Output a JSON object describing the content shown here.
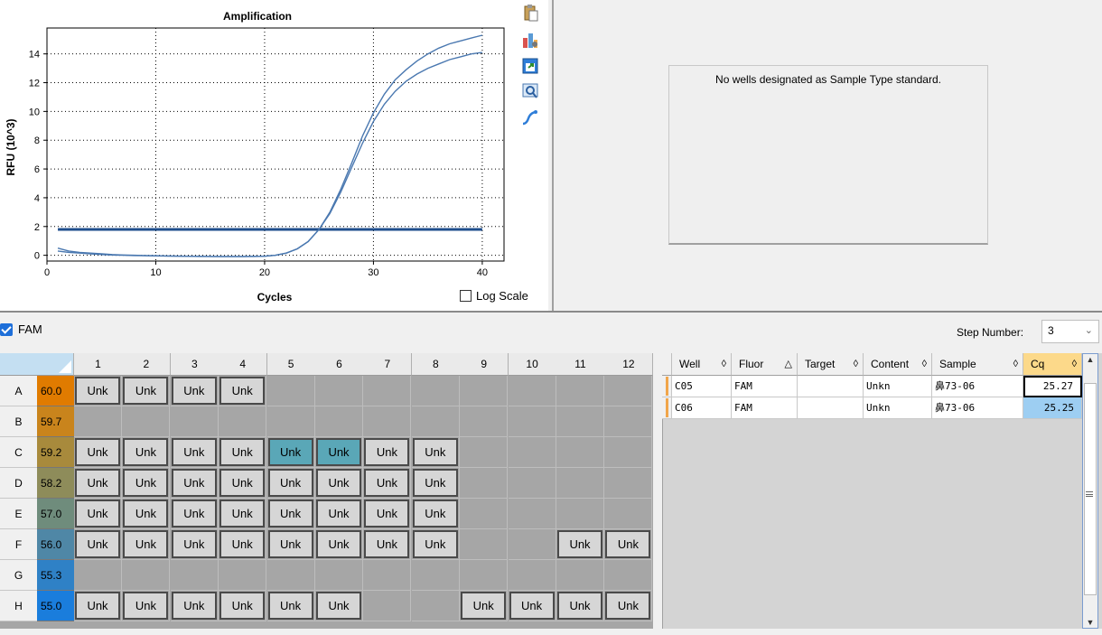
{
  "chart_data": {
    "type": "line",
    "title": "Amplification",
    "xlabel": "Cycles",
    "ylabel": "RFU (10^3)",
    "xlim": [
      0,
      42
    ],
    "ylim": [
      -0.4,
      15.8
    ],
    "xticks": [
      0,
      10,
      20,
      30,
      40
    ],
    "yticks": [
      0,
      2,
      4,
      6,
      8,
      10,
      12,
      14
    ],
    "grid": true,
    "threshold": 1.8,
    "x": [
      1,
      2,
      3,
      4,
      5,
      6,
      7,
      8,
      9,
      10,
      11,
      12,
      13,
      14,
      15,
      16,
      17,
      18,
      19,
      20,
      21,
      22,
      23,
      24,
      25,
      26,
      27,
      28,
      29,
      30,
      31,
      32,
      33,
      34,
      35,
      36,
      37,
      38,
      39,
      40
    ],
    "series": [
      {
        "values": [
          0.5,
          0.3,
          0.2,
          0.15,
          0.1,
          0.05,
          0.02,
          0.0,
          -0.02,
          -0.03,
          -0.05,
          -0.06,
          -0.07,
          -0.08,
          -0.08,
          -0.09,
          -0.09,
          -0.09,
          -0.08,
          -0.07,
          0.0,
          0.15,
          0.45,
          0.95,
          1.8,
          3.0,
          4.6,
          6.4,
          8.3,
          9.9,
          11.2,
          12.2,
          12.9,
          13.5,
          14.0,
          14.4,
          14.7,
          14.9,
          15.1,
          15.3
        ]
      },
      {
        "values": [
          0.3,
          0.2,
          0.15,
          0.1,
          0.05,
          0.02,
          0.0,
          -0.02,
          -0.03,
          -0.04,
          -0.05,
          -0.06,
          -0.07,
          -0.07,
          -0.08,
          -0.08,
          -0.08,
          -0.08,
          -0.07,
          -0.06,
          0.0,
          0.15,
          0.45,
          0.95,
          1.8,
          2.9,
          4.4,
          6.1,
          7.8,
          9.3,
          10.5,
          11.4,
          12.1,
          12.6,
          13.0,
          13.3,
          13.6,
          13.8,
          14.0,
          14.1
        ]
      }
    ],
    "colors": {
      "curves": "#4a78b0",
      "threshold": "#1f4e8c"
    }
  },
  "chart": {
    "log_scale_label": "Log Scale",
    "log_scale_checked": false,
    "tools": [
      "clipboard-icon",
      "chart-settings-icon",
      "export-icon",
      "zoom-icon",
      "curve-fit-icon"
    ]
  },
  "standard_curve": {
    "message": "No wells designated as Sample Type standard."
  },
  "fluor_toggle": {
    "label": "FAM",
    "checked": true
  },
  "step": {
    "label": "Step Number:",
    "value": "3"
  },
  "plate": {
    "columns": [
      "1",
      "2",
      "3",
      "4",
      "5",
      "6",
      "7",
      "8",
      "9",
      "10",
      "11",
      "12"
    ],
    "rows": [
      {
        "label": "A",
        "temp": "60.0",
        "color": "#e07b00",
        "wells": [
          "Unk",
          "Unk",
          "Unk",
          "Unk",
          "",
          "",
          "",
          "",
          "",
          "",
          "",
          ""
        ]
      },
      {
        "label": "B",
        "temp": "59.7",
        "color": "#c9841c",
        "wells": [
          "",
          "",
          "",
          "",
          "",
          "",
          "",
          "",
          "",
          "",
          "",
          ""
        ]
      },
      {
        "label": "C",
        "temp": "59.2",
        "color": "#a88a3c",
        "wells": [
          "Unk",
          "Unk",
          "Unk",
          "Unk",
          "Unk",
          "Unk",
          "Unk",
          "Unk",
          "",
          "",
          "",
          ""
        ]
      },
      {
        "label": "D",
        "temp": "58.2",
        "color": "#8e8c5a",
        "wells": [
          "Unk",
          "Unk",
          "Unk",
          "Unk",
          "Unk",
          "Unk",
          "Unk",
          "Unk",
          "",
          "",
          "",
          ""
        ]
      },
      {
        "label": "E",
        "temp": "57.0",
        "color": "#6f8c7c",
        "wells": [
          "Unk",
          "Unk",
          "Unk",
          "Unk",
          "Unk",
          "Unk",
          "Unk",
          "Unk",
          "",
          "",
          "",
          ""
        ]
      },
      {
        "label": "F",
        "temp": "56.0",
        "color": "#4f87a6",
        "wells": [
          "Unk",
          "Unk",
          "Unk",
          "Unk",
          "Unk",
          "Unk",
          "Unk",
          "Unk",
          "",
          "",
          "Unk",
          "Unk"
        ]
      },
      {
        "label": "G",
        "temp": "55.3",
        "color": "#2f81c6",
        "wells": [
          "",
          "",
          "",
          "",
          "",
          "",
          "",
          "",
          "",
          "",
          "",
          ""
        ]
      },
      {
        "label": "H",
        "temp": "55.0",
        "color": "#1a7ddc",
        "wells": [
          "Unk",
          "Unk",
          "Unk",
          "Unk",
          "Unk",
          "Unk",
          "",
          "",
          "Unk",
          "Unk",
          "Unk",
          "Unk"
        ]
      }
    ],
    "selected": [
      [
        2,
        4
      ],
      [
        2,
        5
      ]
    ]
  },
  "results": {
    "headers": [
      {
        "label": "Well",
        "sort": "◊"
      },
      {
        "label": "Fluor",
        "sort": "△"
      },
      {
        "label": "Target",
        "sort": "◊"
      },
      {
        "label": "Content",
        "sort": "◊"
      },
      {
        "label": "Sample",
        "sort": "◊"
      },
      {
        "label": "Cq",
        "sort": "◊"
      }
    ],
    "rows": [
      {
        "well": "C05",
        "fluor": "FAM",
        "target": "",
        "content": "Unkn",
        "sample": "鼻73-06",
        "cq": "25.27"
      },
      {
        "well": "C06",
        "fluor": "FAM",
        "target": "",
        "content": "Unkn",
        "sample": "鼻73-06",
        "cq": "25.25"
      }
    ]
  }
}
